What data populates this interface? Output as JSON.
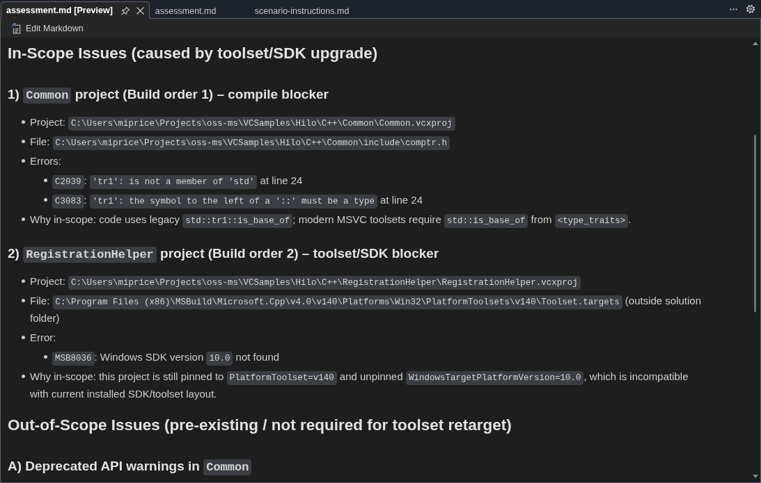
{
  "tabs": [
    {
      "label": "assessment.md [Preview]",
      "selected": true
    },
    {
      "label": "assessment.md",
      "selected": false
    },
    {
      "label": "scenario-instructions.md",
      "selected": false
    }
  ],
  "toolbar": {
    "edit_button": "Edit Markdown"
  },
  "document": [
    {
      "kind": "h2",
      "parts": [
        {
          "kind": "text",
          "text": "In-Scope Issues (caused by toolset/SDK upgrade)"
        }
      ]
    },
    {
      "kind": "h3",
      "parts": [
        {
          "kind": "text",
          "text": "1) "
        },
        {
          "kind": "code",
          "text": "Common"
        },
        {
          "kind": "text",
          "text": " project (Build order 1) – compile blocker"
        }
      ]
    },
    {
      "kind": "list",
      "items": [
        {
          "parts": [
            {
              "kind": "text",
              "text": "Project: "
            },
            {
              "kind": "code",
              "text": "C:\\Users\\miprice\\Projects\\oss-ms\\VCSamples\\Hilo\\C++\\Common\\Common.vcxproj"
            }
          ]
        },
        {
          "parts": [
            {
              "kind": "text",
              "text": "File: "
            },
            {
              "kind": "code",
              "text": "C:\\Users\\miprice\\Projects\\oss-ms\\VCSamples\\Hilo\\C++\\Common\\include\\comptr.h"
            }
          ]
        },
        {
          "parts": [
            {
              "kind": "text",
              "text": "Errors:"
            }
          ],
          "children": [
            {
              "parts": [
                {
                  "kind": "code",
                  "text": "C2039"
                },
                {
                  "kind": "text",
                  "text": ": "
                },
                {
                  "kind": "code",
                  "text": "'tr1': is not a member of 'std'"
                },
                {
                  "kind": "text",
                  "text": " at line 24"
                }
              ]
            },
            {
              "parts": [
                {
                  "kind": "code",
                  "text": "C3083"
                },
                {
                  "kind": "text",
                  "text": ": "
                },
                {
                  "kind": "code",
                  "text": "'tr1': the symbol to the left of a '::' must be a type"
                },
                {
                  "kind": "text",
                  "text": " at line 24"
                }
              ]
            }
          ]
        },
        {
          "parts": [
            {
              "kind": "text",
              "text": "Why in-scope: code uses legacy "
            },
            {
              "kind": "code",
              "text": "std::tr1::is_base_of"
            },
            {
              "kind": "text",
              "text": "; modern MSVC toolsets require "
            },
            {
              "kind": "code",
              "text": "std::is_base_of"
            },
            {
              "kind": "text",
              "text": " from "
            },
            {
              "kind": "code",
              "text": "<type_traits>"
            },
            {
              "kind": "text",
              "text": "."
            }
          ]
        }
      ]
    },
    {
      "kind": "h3",
      "parts": [
        {
          "kind": "text",
          "text": "2) "
        },
        {
          "kind": "code",
          "text": "RegistrationHelper"
        },
        {
          "kind": "text",
          "text": " project (Build order 2) – toolset/SDK blocker"
        }
      ]
    },
    {
      "kind": "list",
      "items": [
        {
          "parts": [
            {
              "kind": "text",
              "text": "Project: "
            },
            {
              "kind": "code",
              "text": "C:\\Users\\miprice\\Projects\\oss-ms\\VCSamples\\Hilo\\C++\\RegistrationHelper\\RegistrationHelper.vcxproj"
            }
          ]
        },
        {
          "parts": [
            {
              "kind": "text",
              "text": "File: "
            },
            {
              "kind": "code",
              "text": "C:\\Program Files (x86)\\MSBuild\\Microsoft.Cpp\\v4.0\\v140\\Platforms\\Win32\\PlatformToolsets\\v140\\Toolset.targets"
            },
            {
              "kind": "text",
              "text": " (outside solution folder)"
            }
          ]
        },
        {
          "parts": [
            {
              "kind": "text",
              "text": "Error:"
            }
          ],
          "children": [
            {
              "parts": [
                {
                  "kind": "code",
                  "text": "MSB8036"
                },
                {
                  "kind": "text",
                  "text": ": Windows SDK version "
                },
                {
                  "kind": "code",
                  "text": "10.0"
                },
                {
                  "kind": "text",
                  "text": " not found"
                }
              ]
            }
          ]
        },
        {
          "parts": [
            {
              "kind": "text",
              "text": "Why in-scope: this project is still pinned to "
            },
            {
              "kind": "code",
              "text": "PlatformToolset=v140"
            },
            {
              "kind": "text",
              "text": " and unpinned "
            },
            {
              "kind": "code",
              "text": "WindowsTargetPlatformVersion=10.0"
            },
            {
              "kind": "text",
              "text": ", which is incompatible with current installed SDK/toolset layout."
            }
          ]
        }
      ]
    },
    {
      "kind": "h2",
      "parts": [
        {
          "kind": "text",
          "text": "Out-of-Scope Issues (pre-existing / not required for toolset retarget)"
        }
      ]
    },
    {
      "kind": "h3",
      "parts": [
        {
          "kind": "text",
          "text": "A) Deprecated API warnings in "
        },
        {
          "kind": "code",
          "text": "Common"
        }
      ]
    }
  ]
}
